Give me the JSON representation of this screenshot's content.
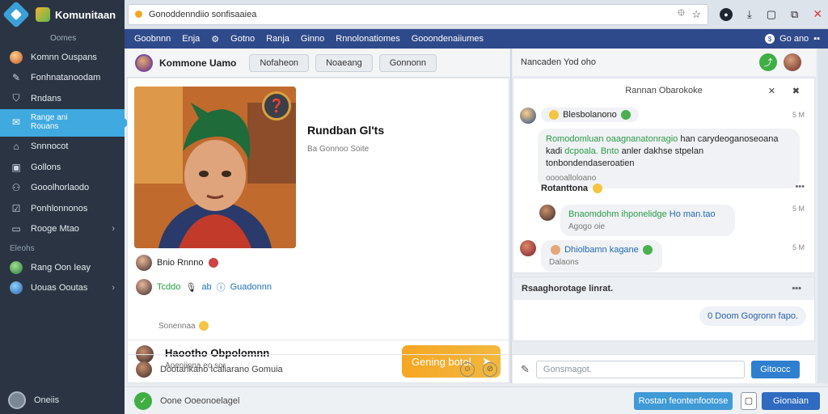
{
  "app": {
    "brand_name": "Komunitaan",
    "brand_sub": "Oomes"
  },
  "address_bar": {
    "url": "Gonoddenndiio sonfisaaiea"
  },
  "navbar": {
    "items": [
      "Goobnnn",
      "Enja",
      "Gotno",
      "Ranja",
      "Ginno",
      "Rnnolonatiomes",
      "Gooondenaiiumes"
    ],
    "right_text": "Go ano"
  },
  "sidebar": {
    "items": [
      {
        "label": "Komnn Ouspans",
        "icon": "avatar-icon"
      },
      {
        "label": "Fonhnatanoodam",
        "icon": "tools-icon"
      },
      {
        "label": "Rndans",
        "icon": "shield-icon"
      },
      {
        "label": "Range ani\nRouans",
        "icon": "chat-icon",
        "active": true
      },
      {
        "label": "Snnnocot",
        "icon": "home-icon"
      },
      {
        "label": "Gollons",
        "icon": "box-icon"
      },
      {
        "label": "Gooolhorlaodo",
        "icon": "share-icon"
      },
      {
        "label": "Ponhlonnonos",
        "icon": "check-icon"
      },
      {
        "label": "Rooge Mtao",
        "icon": "folder-icon",
        "chevron": true
      }
    ],
    "section_label": "Eleohs",
    "bottom_items": [
      {
        "label": "Rang Oon Ieay"
      },
      {
        "label": "Uouas Ooutas",
        "chevron": true
      }
    ],
    "footer_label": "Oneiis"
  },
  "profile_header": {
    "username": "Kommone Uamo",
    "buttons": [
      "Nofaheon",
      "Noaeang",
      "Gonnonn"
    ]
  },
  "profile_card": {
    "title": "Rundban Gl'ts",
    "subtitle": "Ba Gonnoo Soite",
    "friend_row_1": "Bnio Rnnno",
    "friend_row_2_green": "Tcddo",
    "friend_row_2_blue": "Guadonnn",
    "friend_row_2_mid": "ab",
    "friend_sub": "Sonennaa",
    "profile_name": "Haootho Obpolomnn",
    "profile_sub": "Aoeniinna eo sor",
    "cta_label": "Gening botol.",
    "compose_text": "Dootarikano Icaliarano Gomuia"
  },
  "right_panel": {
    "header_text": "Nancaden Yod oho",
    "chat_title": "Rannan Obarokoke",
    "messages": [
      {
        "name": "Blesbolanono",
        "text_green": "Romodomluan oaagnanatonragio",
        "text_1": "han carydeoganoseoana kadi",
        "text_green_2": "dcpoala. Bnto",
        "text_2": "anler dakhse stpelan tonbondendaseroatien",
        "sub": "ooooalloloano",
        "time": "5 M"
      },
      {
        "name": "Rotanttona",
        "time": ""
      },
      {
        "text_green": "Bnaomdohm ihponelidge",
        "text_rest": "Ho man.tao",
        "sub": "Agogo oie",
        "time": "5 M"
      },
      {
        "name_blue": "Dhiolbamn kagane",
        "sub": "Dalaons",
        "time": "5 M"
      }
    ],
    "note_title": "Rsaaghorotage linrat.",
    "note_bubble": "0 Doom Gogronn fapo.",
    "input_placeholder": "Gonsmagot.",
    "send_label": "Gitoocc"
  },
  "footer": {
    "status_text": "Oone Ooeonoelagel",
    "btn_primary": "Rostan feontenfootose",
    "btn_blue": "Gionaian"
  },
  "colors": {
    "sidebar_bg": "#2b3442",
    "accent": "#3fa9e0",
    "nav_bg": "#2f4a8a",
    "cta": "#f6a623",
    "green": "#3fae45"
  }
}
